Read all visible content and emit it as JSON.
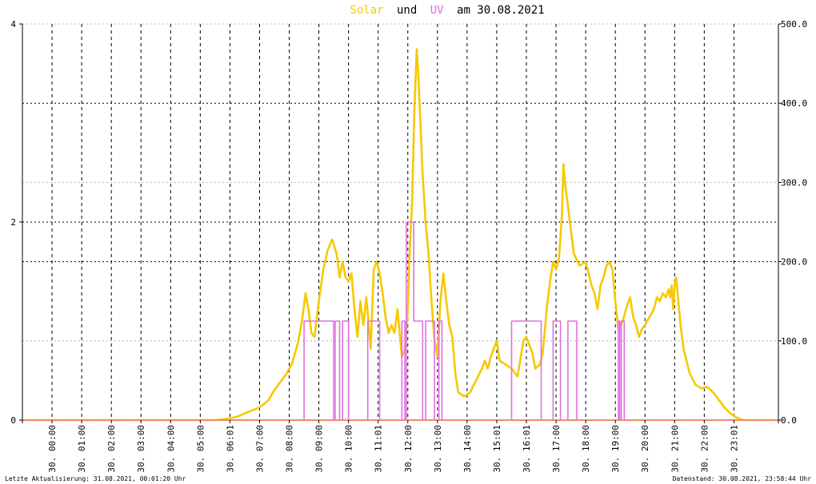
{
  "title": {
    "part1": "Solar",
    "part2": "und",
    "part3": "UV",
    "part4": "am 30.08.2021"
  },
  "footer": {
    "left": "Letzte Aktualisierung: 31.08.2021, 00:01:20 Uhr",
    "right": "Datenstand: 30.08.2021, 23:58:44 Uhr"
  },
  "colors": {
    "solar": "#f7c800",
    "uv": "#e070e0",
    "baseline": "#f08a70",
    "grid": "#000000"
  },
  "chart_data": {
    "type": "line",
    "title": "Solar und UV am 30.08.2021",
    "xlabel": "",
    "x_range_hours": [
      0,
      25.5
    ],
    "x_ticks": [
      "30. 00:00",
      "30. 01:00",
      "30. 02:00",
      "30. 03:00",
      "30. 04:00",
      "30. 05:00",
      "30. 06:01",
      "30. 07:00",
      "30. 08:00",
      "30. 09:00",
      "30. 10:00",
      "30. 11:01",
      "30. 12:00",
      "30. 13:00",
      "30. 14:00",
      "30. 15:01",
      "30. 16:01",
      "30. 17:00",
      "30. 18:00",
      "30. 19:00",
      "30. 20:00",
      "30. 21:00",
      "30. 22:00",
      "30. 23:01"
    ],
    "y_left": {
      "label": "UV",
      "range": [
        0,
        4
      ],
      "ticks": [
        "0",
        "2",
        "4"
      ]
    },
    "y_right": {
      "label": "Solar",
      "range": [
        0,
        500
      ],
      "ticks": [
        "0.0",
        "100.0",
        "200.0",
        "300.0",
        "400.0",
        "500.0"
      ]
    },
    "grid": true,
    "series": [
      {
        "name": "Solar",
        "axis": "right",
        "color": "#f7c800",
        "points": [
          [
            0,
            0
          ],
          [
            6.5,
            0
          ],
          [
            7.0,
            2
          ],
          [
            7.3,
            5
          ],
          [
            7.6,
            10
          ],
          [
            8.0,
            16
          ],
          [
            8.3,
            25
          ],
          [
            8.5,
            38
          ],
          [
            8.7,
            48
          ],
          [
            8.9,
            58
          ],
          [
            9.1,
            72
          ],
          [
            9.3,
            98
          ],
          [
            9.45,
            130
          ],
          [
            9.55,
            160
          ],
          [
            9.65,
            140
          ],
          [
            9.75,
            110
          ],
          [
            9.85,
            105
          ],
          [
            10.0,
            150
          ],
          [
            10.15,
            190
          ],
          [
            10.3,
            215
          ],
          [
            10.45,
            228
          ],
          [
            10.6,
            210
          ],
          [
            10.7,
            180
          ],
          [
            10.8,
            200
          ],
          [
            10.9,
            180
          ],
          [
            11.0,
            175
          ],
          [
            11.1,
            185
          ],
          [
            11.2,
            140
          ],
          [
            11.3,
            105
          ],
          [
            11.4,
            150
          ],
          [
            11.5,
            120
          ],
          [
            11.6,
            155
          ],
          [
            11.7,
            112
          ],
          [
            11.75,
            90
          ],
          [
            11.85,
            190
          ],
          [
            11.95,
            200
          ],
          [
            12.05,
            185
          ],
          [
            12.15,
            160
          ],
          [
            12.25,
            130
          ],
          [
            12.35,
            110
          ],
          [
            12.45,
            120
          ],
          [
            12.55,
            110
          ],
          [
            12.65,
            140
          ],
          [
            12.75,
            100
          ],
          [
            12.8,
            80
          ],
          [
            12.9,
            90
          ],
          [
            13.0,
            140
          ],
          [
            13.05,
            200
          ],
          [
            13.15,
            280
          ],
          [
            13.22,
            390
          ],
          [
            13.3,
            468
          ],
          [
            13.35,
            440
          ],
          [
            13.42,
            380
          ],
          [
            13.5,
            310
          ],
          [
            13.6,
            250
          ],
          [
            13.7,
            210
          ],
          [
            13.8,
            150
          ],
          [
            13.9,
            100
          ],
          [
            14.0,
            80
          ],
          [
            14.1,
            150
          ],
          [
            14.2,
            185
          ],
          [
            14.3,
            150
          ],
          [
            14.4,
            120
          ],
          [
            14.5,
            105
          ],
          [
            14.6,
            60
          ],
          [
            14.7,
            35
          ],
          [
            14.9,
            30
          ],
          [
            15.1,
            35
          ],
          [
            15.3,
            50
          ],
          [
            15.5,
            65
          ],
          [
            15.6,
            75
          ],
          [
            15.7,
            65
          ],
          [
            15.8,
            80
          ],
          [
            15.9,
            90
          ],
          [
            16.0,
            100
          ],
          [
            16.1,
            75
          ],
          [
            16.3,
            70
          ],
          [
            16.5,
            65
          ],
          [
            16.7,
            55
          ],
          [
            16.9,
            100
          ],
          [
            17.0,
            105
          ],
          [
            17.2,
            85
          ],
          [
            17.3,
            65
          ],
          [
            17.45,
            70
          ],
          [
            17.55,
            85
          ],
          [
            17.7,
            145
          ],
          [
            17.8,
            175
          ],
          [
            17.9,
            200
          ],
          [
            18.0,
            190
          ],
          [
            18.1,
            205
          ],
          [
            18.2,
            260
          ],
          [
            18.25,
            323
          ],
          [
            18.3,
            300
          ],
          [
            18.4,
            270
          ],
          [
            18.5,
            240
          ],
          [
            18.6,
            210
          ],
          [
            18.8,
            195
          ],
          [
            19.0,
            200
          ],
          [
            19.1,
            185
          ],
          [
            19.2,
            170
          ],
          [
            19.3,
            160
          ],
          [
            19.4,
            140
          ],
          [
            19.5,
            170
          ],
          [
            19.6,
            180
          ],
          [
            19.7,
            195
          ],
          [
            19.8,
            200
          ],
          [
            19.9,
            190
          ],
          [
            20.0,
            150
          ],
          [
            20.1,
            115
          ],
          [
            20.25,
            125
          ],
          [
            20.4,
            145
          ],
          [
            20.5,
            155
          ],
          [
            20.6,
            130
          ],
          [
            20.7,
            120
          ],
          [
            20.8,
            105
          ],
          [
            20.9,
            115
          ],
          [
            21.0,
            120
          ],
          [
            21.15,
            130
          ],
          [
            21.3,
            140
          ],
          [
            21.4,
            155
          ],
          [
            21.5,
            150
          ],
          [
            21.6,
            160
          ],
          [
            21.7,
            155
          ],
          [
            21.8,
            165
          ],
          [
            21.85,
            155
          ],
          [
            21.9,
            170
          ],
          [
            21.95,
            140
          ],
          [
            22.0,
            170
          ],
          [
            22.05,
            180
          ],
          [
            22.1,
            160
          ],
          [
            22.2,
            120
          ],
          [
            22.3,
            90
          ],
          [
            22.5,
            60
          ],
          [
            22.7,
            45
          ],
          [
            22.9,
            40
          ],
          [
            23.1,
            42
          ],
          [
            23.3,
            35
          ],
          [
            23.5,
            25
          ],
          [
            23.7,
            15
          ],
          [
            23.9,
            8
          ],
          [
            24.1,
            3
          ],
          [
            24.3,
            0
          ],
          [
            25.5,
            0
          ]
        ]
      },
      {
        "name": "UV",
        "axis": "left",
        "color": "#e070e0",
        "points": [
          [
            0,
            0
          ],
          [
            9.5,
            0
          ],
          [
            9.5,
            1
          ],
          [
            10.5,
            1
          ],
          [
            10.5,
            0
          ],
          [
            10.55,
            0
          ],
          [
            10.55,
            1
          ],
          [
            10.7,
            1
          ],
          [
            10.7,
            0
          ],
          [
            10.8,
            0
          ],
          [
            10.8,
            1
          ],
          [
            11.0,
            1
          ],
          [
            11.0,
            0
          ],
          [
            11.65,
            0
          ],
          [
            11.65,
            1
          ],
          [
            12.05,
            1
          ],
          [
            12.05,
            0
          ],
          [
            12.8,
            0
          ],
          [
            12.8,
            1
          ],
          [
            12.9,
            1
          ],
          [
            12.9,
            0
          ],
          [
            12.95,
            0
          ],
          [
            12.95,
            2
          ],
          [
            13.2,
            2
          ],
          [
            13.2,
            1
          ],
          [
            13.5,
            1
          ],
          [
            13.5,
            0
          ],
          [
            13.6,
            0
          ],
          [
            13.6,
            1
          ],
          [
            13.9,
            1
          ],
          [
            13.9,
            0
          ],
          [
            14.05,
            0
          ],
          [
            14.05,
            1
          ],
          [
            14.15,
            1
          ],
          [
            14.15,
            0
          ],
          [
            16.5,
            0
          ],
          [
            16.5,
            1
          ],
          [
            17.5,
            1
          ],
          [
            17.5,
            0
          ],
          [
            17.9,
            0
          ],
          [
            17.9,
            1
          ],
          [
            18.15,
            1
          ],
          [
            18.15,
            0
          ],
          [
            18.4,
            0
          ],
          [
            18.4,
            1
          ],
          [
            18.7,
            1
          ],
          [
            18.7,
            0
          ],
          [
            20.1,
            0
          ],
          [
            20.1,
            1
          ],
          [
            20.15,
            1
          ],
          [
            20.15,
            0
          ],
          [
            20.2,
            0
          ],
          [
            20.2,
            1
          ],
          [
            20.3,
            1
          ],
          [
            20.3,
            0
          ],
          [
            25.5,
            0
          ]
        ]
      }
    ]
  }
}
